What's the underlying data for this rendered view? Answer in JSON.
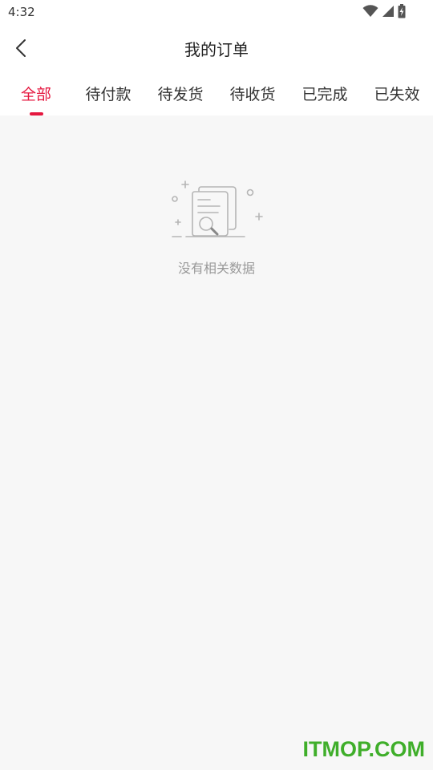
{
  "status_bar": {
    "time": "4:32"
  },
  "header": {
    "title": "我的订单",
    "back_icon": "chevron-left-icon"
  },
  "tabs": [
    {
      "label": "全部",
      "active": true
    },
    {
      "label": "待付款",
      "active": false
    },
    {
      "label": "待发货",
      "active": false
    },
    {
      "label": "待收货",
      "active": false
    },
    {
      "label": "已完成",
      "active": false
    },
    {
      "label": "已失效",
      "active": false
    }
  ],
  "empty_state": {
    "text": "没有相关数据",
    "icon": "empty-document-search-icon"
  },
  "watermark": "ITMOP.COM",
  "colors": {
    "accent": "#e5173f",
    "background": "#f7f7f7",
    "watermark": "#3fae2a"
  }
}
